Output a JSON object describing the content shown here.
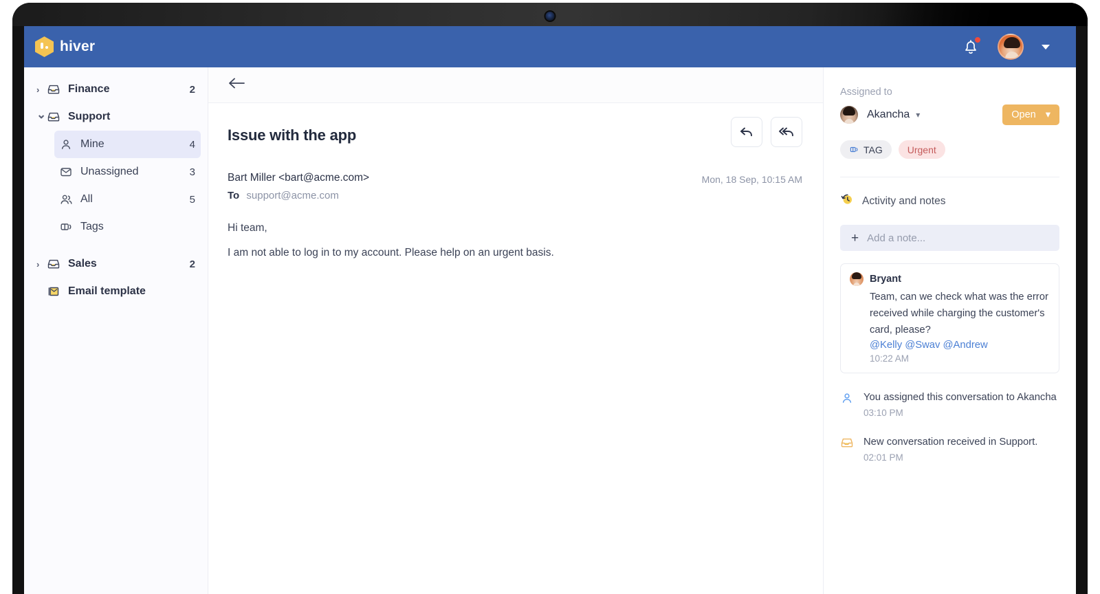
{
  "header": {
    "brand_name": "hiver",
    "logo_icon": "hiver-hexagon-logo",
    "notification_icon": "bell-icon",
    "avatar_icon": "user-avatar",
    "dropdown_icon": "chevron-down-icon"
  },
  "sidebar": {
    "items": [
      {
        "label": "Finance",
        "count": "2",
        "icon": "inbox-icon",
        "caret": "›",
        "level": "top",
        "active": false
      },
      {
        "label": "Support",
        "count": "",
        "icon": "inbox-icon",
        "caret": "⌄",
        "level": "top",
        "active": false
      },
      {
        "label": "Mine",
        "count": "4",
        "icon": "person-icon",
        "caret": "",
        "level": "sub",
        "active": true
      },
      {
        "label": "Unassigned",
        "count": "3",
        "icon": "envelope-icon",
        "caret": "",
        "level": "sub",
        "active": false
      },
      {
        "label": "All",
        "count": "5",
        "icon": "people-icon",
        "caret": "",
        "level": "sub",
        "active": false
      },
      {
        "label": "Tags",
        "count": "",
        "icon": "tag-icon",
        "caret": "",
        "level": "sub",
        "active": false
      },
      {
        "label": "Sales",
        "count": "2",
        "icon": "inbox-icon",
        "caret": "›",
        "level": "top",
        "active": false
      },
      {
        "label": "Email template",
        "count": "",
        "icon": "email-template-icon",
        "caret": "",
        "level": "top",
        "active": false
      }
    ]
  },
  "conversation": {
    "back_icon": "back-arrow-icon",
    "subject": "Issue with the app",
    "reply_icon": "reply-icon",
    "reply_all_icon": "reply-all-icon",
    "from": "Bart Miller <bart@acme.com>",
    "to_label": "To",
    "to_address": "support@acme.com",
    "timestamp": "Mon, 18 Sep, 10:15 AM",
    "body_lines": [
      "Hi team,",
      "I am not able to log in to my account. Please help on an urgent basis."
    ]
  },
  "right_panel": {
    "assigned_label": "Assigned to",
    "assignee": "Akancha",
    "assignee_avatar": "assignee-avatar",
    "assignee_dropdown_icon": "chevron-down-icon",
    "status": "Open",
    "status_dropdown_icon": "chevron-down-icon",
    "status_color": "#eeb661",
    "chips": [
      {
        "label": "TAG",
        "icon": "tag-icon",
        "style": "tag"
      },
      {
        "label": "Urgent",
        "icon": "",
        "style": "urgent"
      }
    ],
    "activity_title": "Activity and notes",
    "activity_icon": "history-clock-icon",
    "note_input": {
      "plus_icon": "plus-icon",
      "placeholder": "Add a note..."
    },
    "note_card": {
      "author": "Bryant",
      "avatar": "bryant-avatar",
      "body": "Team, can we check what was the error received while charging the customer's card, please?",
      "mentions": "@Kelly @Swav @Andrew",
      "time": "10:22 AM"
    },
    "activity_log": [
      {
        "icon": "person-icon",
        "text": "You assigned this conversation to Akancha",
        "time": "03:10 PM"
      },
      {
        "icon": "inbox-icon",
        "text": "New conversation received in Support.",
        "time": "02:01 PM"
      }
    ]
  }
}
